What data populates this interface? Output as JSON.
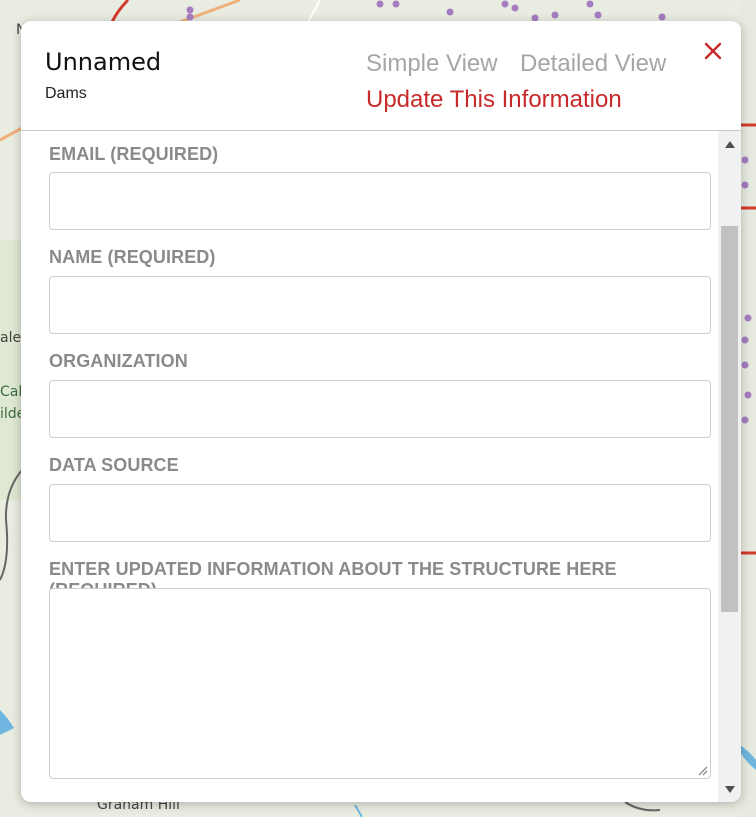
{
  "map": {
    "labels": {
      "place_1": "N",
      "place_2": "ale",
      "park_1": "Cal",
      "park_2": "ilde",
      "hill": "Graham Hill"
    }
  },
  "modal": {
    "title": "Unnamed",
    "subtitle": "Dams",
    "tabs": {
      "simple": "Simple View",
      "detailed": "Detailed View"
    },
    "update_link": "Update This Information",
    "form": {
      "email_label": "EMAIL (REQUIRED)",
      "email_value": "",
      "name_label": "NAME (REQUIRED)",
      "name_value": "",
      "organization_label": "ORGANIZATION",
      "organization_value": "",
      "data_source_label": "DATA SOURCE",
      "data_source_value": "",
      "details_label": "ENTER UPDATED INFORMATION ABOUT THE STRUCTURE HERE (REQUIRED)",
      "details_value": ""
    },
    "icons": {
      "close": "close-icon",
      "scroll_up": "arrow-up-icon",
      "scroll_down": "arrow-down-icon",
      "resize": "resize-handle-icon"
    },
    "colors": {
      "accent_red": "#c82a2a",
      "inactive_tab": "#a6a6a6",
      "label_gray": "#8a8a8a"
    }
  }
}
